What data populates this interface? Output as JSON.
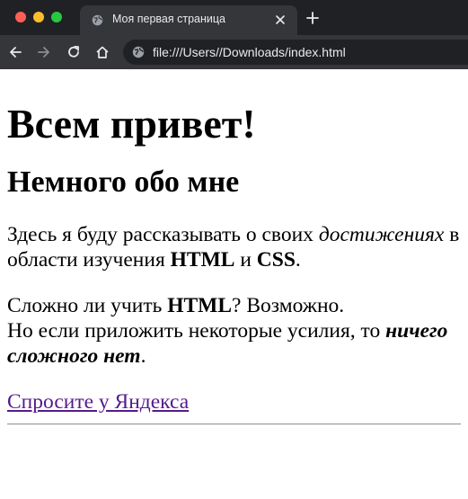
{
  "window": {
    "tab_title": "Моя первая страница",
    "url": "file:///Users//Downloads/index.html"
  },
  "toolbar": {
    "icons": [
      "back-arrow-icon",
      "forward-arrow-icon",
      "reload-icon",
      "home-icon",
      "globe-icon"
    ]
  },
  "page": {
    "h1": "Всем привет!",
    "h2": "Немного обо мне",
    "p1": {
      "t1": "Здесь я буду рассказывать о своих ",
      "em1": "достижениях",
      "t2": " в области изучения ",
      "b1": "HTML",
      "t3": " и ",
      "b2": "CSS",
      "t4": "."
    },
    "p2": {
      "t1": "Сложно ли учить ",
      "b1": "HTML",
      "t2": "? Возможно.",
      "t3": "Но если приложить некоторые усилия, то ",
      "bi1": "ничего сложного нет",
      "t4": "."
    },
    "link_text": "Спросите у Яндекса"
  },
  "colors": {
    "chrome_bg": "#202124",
    "toolbar_bg": "#35363a",
    "link_visited": "#551a8b"
  }
}
